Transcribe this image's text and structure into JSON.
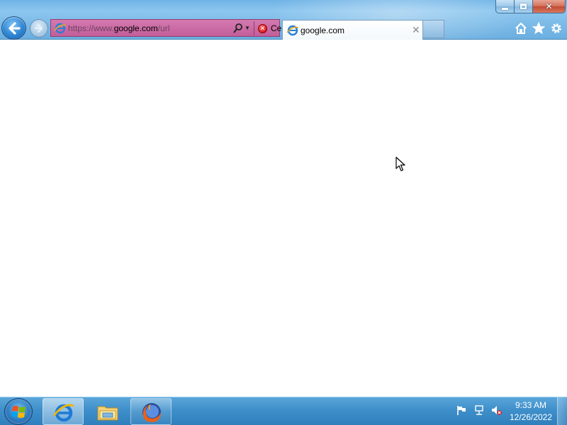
{
  "window": {
    "caption": {
      "minimize": "minimize",
      "restore": "restore",
      "close": "✕"
    }
  },
  "navigation": {
    "back_icon": "back-arrow-icon",
    "forward_icon": "forward-arrow-icon"
  },
  "address_bar": {
    "url_prefix": "https://www.",
    "url_host": "google.com",
    "url_suffix": "/url",
    "error_color": "#c25e9a",
    "certificate_status": "Certific...",
    "certificate_icon": "✕"
  },
  "tabs": [
    {
      "title": "google.com",
      "active": true,
      "close": "✕"
    }
  ],
  "toolbar": {
    "icons": [
      "home-icon",
      "favorites-star-icon",
      "tools-gear-icon"
    ]
  },
  "taskbar": {
    "pinned": [
      "internet-explorer-icon",
      "windows-explorer-icon",
      "firefox-icon"
    ],
    "tray_icons": [
      "action-center-flag-icon",
      "network-icon",
      "volume-muted-icon"
    ],
    "clock": {
      "time": "9:33 AM",
      "date": "12/26/2022"
    }
  },
  "colors": {
    "taskbar": "#3f8fca",
    "frame": "#7fbde9",
    "accent": "#2f86d3"
  }
}
